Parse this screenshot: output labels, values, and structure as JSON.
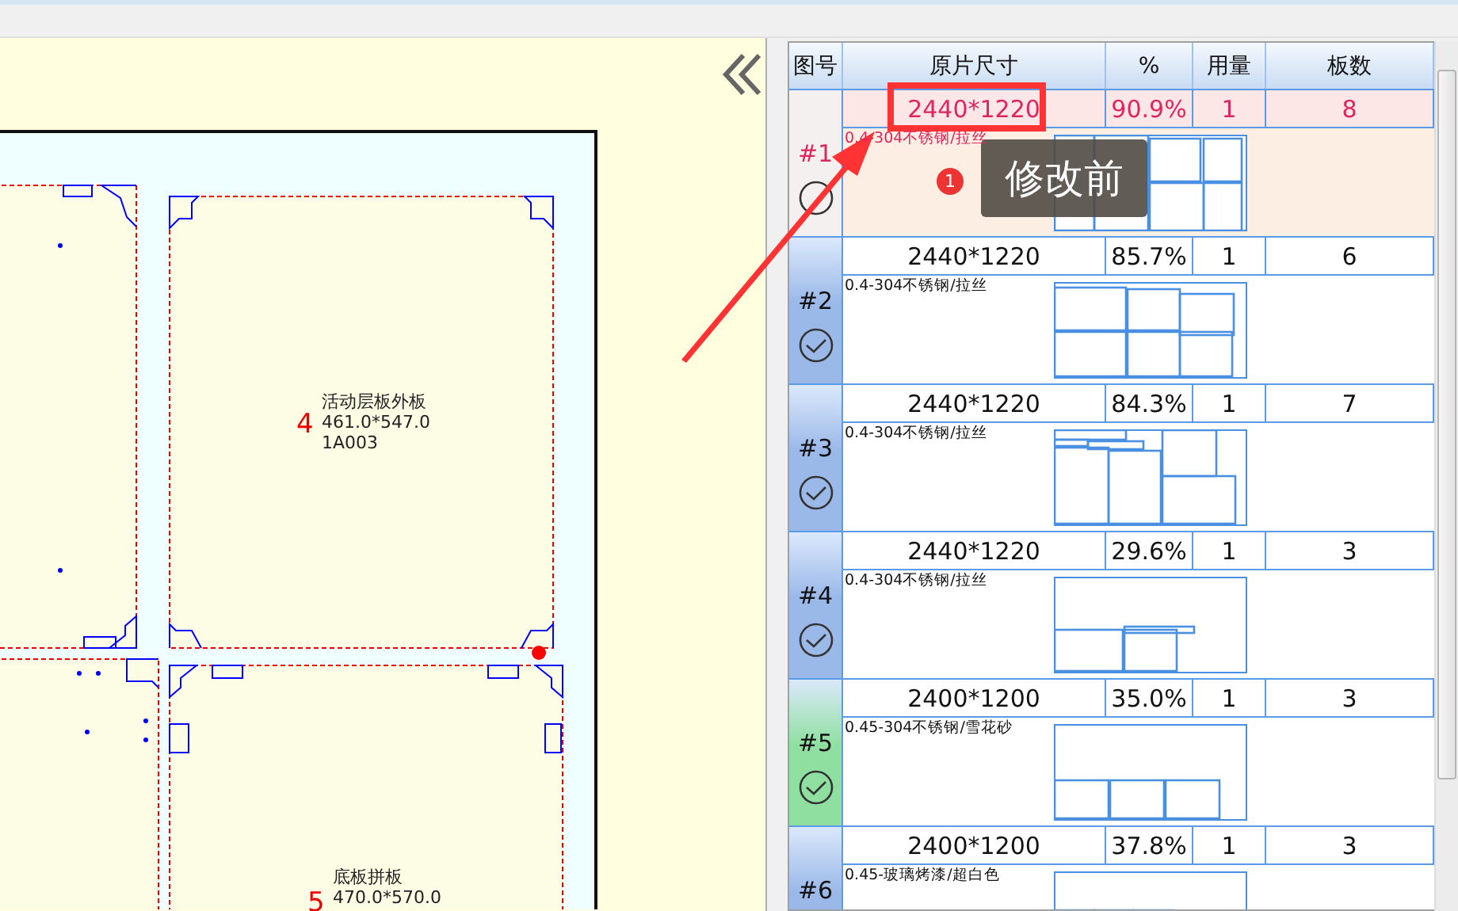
{
  "canvas": {
    "parts": [
      {
        "number": "4",
        "name": "活动层板外板",
        "size": "461.0*547.0",
        "code": "1A003"
      },
      {
        "number": "5",
        "name": "底板拼板",
        "size": "470.0*570.0"
      }
    ]
  },
  "table": {
    "columns": [
      "图号",
      "原片尺寸",
      "%",
      "用量",
      "板数"
    ],
    "rows": [
      {
        "id": "#1",
        "size": "2440*1220",
        "percent": "90.9%",
        "qty": "1",
        "count": "8",
        "material": "0.4-304不锈钢/拉丝",
        "selected": true,
        "checked": false
      },
      {
        "id": "#2",
        "size": "2440*1220",
        "percent": "85.7%",
        "qty": "1",
        "count": "6",
        "material": "0.4-304不锈钢/拉丝",
        "selected": false,
        "checked": true,
        "color": "#9ab8e8"
      },
      {
        "id": "#3",
        "size": "2440*1220",
        "percent": "84.3%",
        "qty": "1",
        "count": "7",
        "material": "0.4-304不锈钢/拉丝",
        "selected": false,
        "checked": true,
        "color": "#9ab8e8"
      },
      {
        "id": "#4",
        "size": "2440*1220",
        "percent": "29.6%",
        "qty": "1",
        "count": "3",
        "material": "0.4-304不锈钢/拉丝",
        "selected": false,
        "checked": true,
        "color": "#9ab8e8"
      },
      {
        "id": "#5",
        "size": "2400*1200",
        "percent": "35.0%",
        "qty": "1",
        "count": "3",
        "material": "0.45-304不锈钢/雪花砂",
        "selected": false,
        "checked": true,
        "color": "#8fe0a0"
      },
      {
        "id": "#6",
        "size": "2400*1200",
        "percent": "37.8%",
        "qty": "1",
        "count": "3",
        "material": "0.45-玻璃烤漆/超白色",
        "selected": false,
        "color": "#9ab8e8"
      }
    ]
  },
  "annotation": {
    "badge": "1",
    "text": "修改前"
  }
}
